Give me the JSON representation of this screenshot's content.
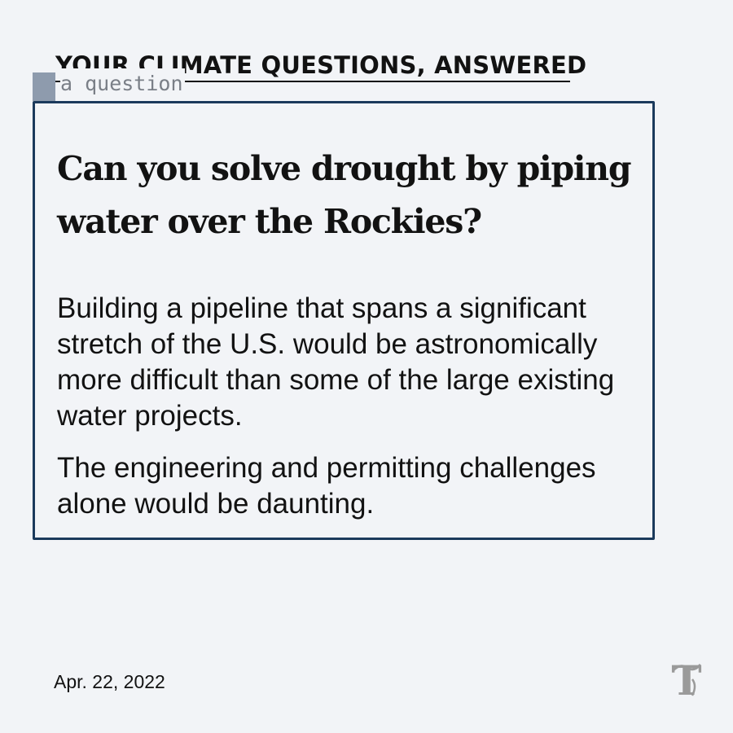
{
  "kicker": "YOUR CLIMATE QUESTIONS, ANSWERED",
  "tag": "a question",
  "card": {
    "headline": "Can you solve drought by piping water over the Rockies?",
    "paragraphs": [
      "Building a pipeline that spans a significant stretch of the U.S. would be astronomically more difficult than some of the large existing water projects.",
      "The engineering and permitting challenges alone would be daunting."
    ]
  },
  "date": "Apr. 22, 2022",
  "logo": {
    "icon": "nyt-t-logo"
  },
  "colors": {
    "background": "#f2f4f7",
    "card_border": "#1b3a5c",
    "text": "#121212",
    "tag_square": "#8e9bad",
    "logo": "#9a9a9a"
  }
}
